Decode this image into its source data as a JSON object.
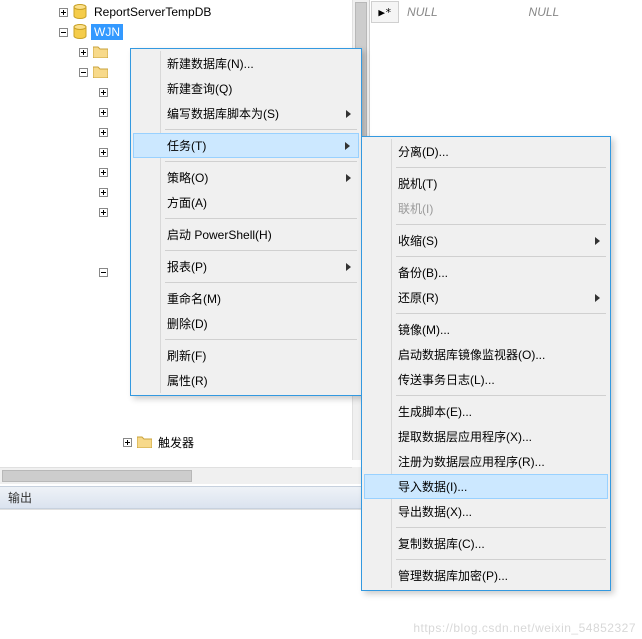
{
  "tree": {
    "db_temp": "ReportServerTempDB",
    "db_sel": "WJN",
    "triggers": "触发器"
  },
  "grid": {
    "row_marker": "▶*",
    "null1": "NULL",
    "null2": "NULL"
  },
  "output": {
    "title": "输出"
  },
  "menu1": {
    "new_db": "新建数据库(N)...",
    "new_query": "新建查询(Q)",
    "script_as": "编写数据库脚本为(S)",
    "tasks": "任务(T)",
    "policies": "策略(O)",
    "facets": "方面(A)",
    "powershell": "启动 PowerShell(H)",
    "reports": "报表(P)",
    "rename": "重命名(M)",
    "delete": "删除(D)",
    "refresh": "刷新(F)",
    "properties": "属性(R)"
  },
  "menu2": {
    "detach": "分离(D)...",
    "offline": "脱机(T)",
    "online": "联机(I)",
    "shrink": "收缩(S)",
    "backup": "备份(B)...",
    "restore": "还原(R)",
    "mirror": "镜像(M)...",
    "launch_monitor": "启动数据库镜像监视器(O)...",
    "ship_logs": "传送事务日志(L)...",
    "gen_scripts": "生成脚本(E)...",
    "extract_dac": "提取数据层应用程序(X)...",
    "register_dac": "注册为数据层应用程序(R)...",
    "import_data": "导入数据(I)...",
    "export_data": "导出数据(X)...",
    "copy_db": "复制数据库(C)...",
    "manage_enc": "管理数据库加密(P)..."
  },
  "watermark": "https://blog.csdn.net/weixin_54852327"
}
